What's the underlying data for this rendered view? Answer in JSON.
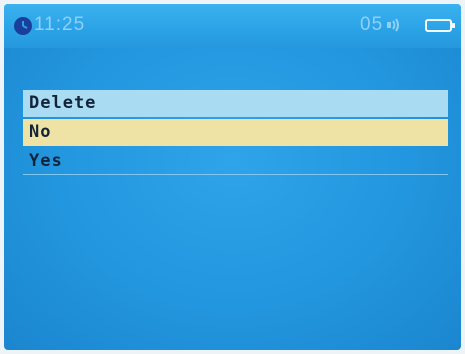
{
  "status_bar": {
    "time": "11:25",
    "track_number": "05",
    "icons": [
      "clock-icon",
      "volume-icon",
      "battery-icon"
    ]
  },
  "menu": {
    "title": "Delete",
    "options": [
      {
        "label": "No",
        "selected": true
      },
      {
        "label": "Yes",
        "selected": false
      }
    ]
  },
  "colors": {
    "screen_background": "#2296de",
    "status_text": "#8fd0f7",
    "title_row": "#a9dbf2",
    "selected_row": "#eee3a4",
    "menu_text": "#12243a"
  }
}
